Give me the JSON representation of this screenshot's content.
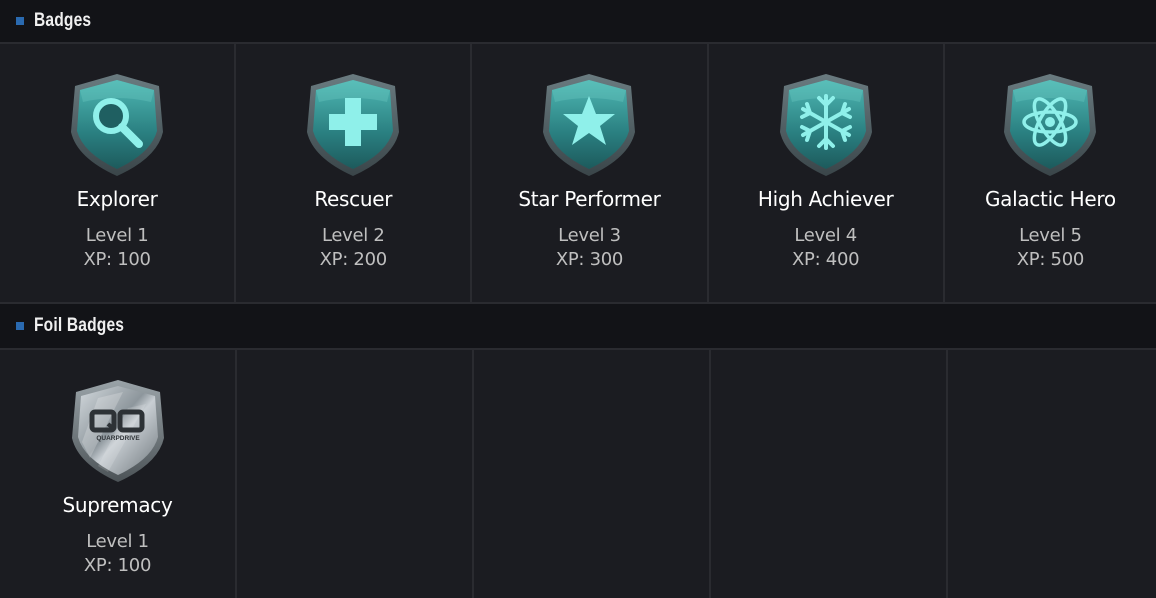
{
  "sections": [
    {
      "title": "Badges",
      "badges": [
        {
          "name": "Explorer",
          "level": "Level 1",
          "xp": "XP: 100",
          "icon": "magnifier-icon"
        },
        {
          "name": "Rescuer",
          "level": "Level 2",
          "xp": "XP: 200",
          "icon": "plus-icon"
        },
        {
          "name": "Star Performer",
          "level": "Level 3",
          "xp": "XP: 300",
          "icon": "star-icon"
        },
        {
          "name": "High Achiever",
          "level": "Level 4",
          "xp": "XP: 400",
          "icon": "snowflake-icon"
        },
        {
          "name": "Galactic Hero",
          "level": "Level 5",
          "xp": "XP: 500",
          "icon": "atom-icon"
        }
      ]
    },
    {
      "title": "Foil Badges",
      "badges": [
        {
          "name": "Supremacy",
          "level": "Level 1",
          "xp": "XP: 100",
          "icon": "quarpdrive-logo-icon",
          "logo_text": "QUARPDRIVE"
        }
      ]
    }
  ],
  "colors": {
    "teal": "#3fa6a6",
    "teal_light": "#7fe6e0",
    "silver": "#a9b0b6",
    "marker": "#2a6ab0"
  }
}
